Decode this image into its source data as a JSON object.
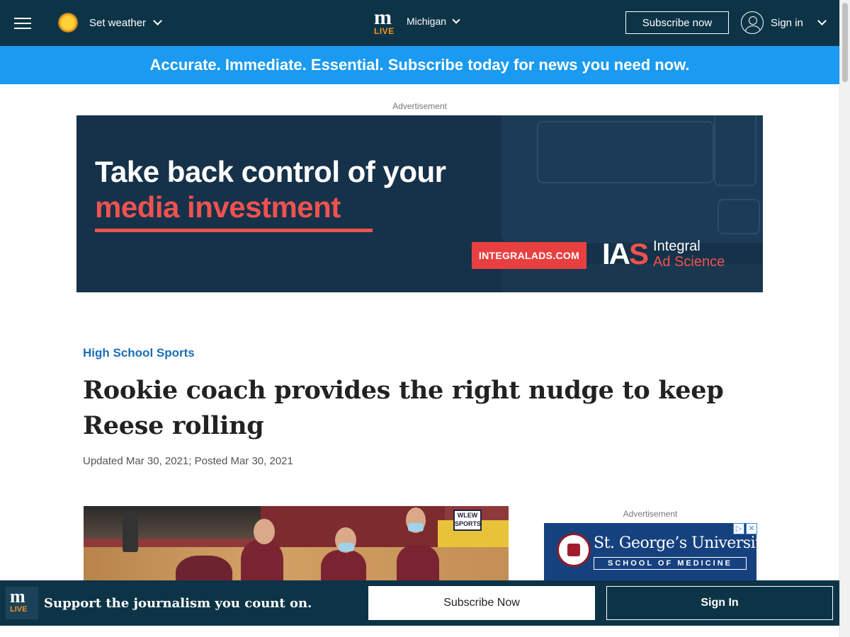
{
  "header": {
    "menu_icon": "hamburger-menu-icon",
    "weather_label": "Set weather",
    "logo_m": "m",
    "logo_live": "LIVE",
    "region_label": "Michigan",
    "subscribe_label": "Subscribe now",
    "signin_label": "Sign in"
  },
  "promo": {
    "text": "Accurate. Immediate. Essential. Subscribe today for news you need now."
  },
  "top_ad": {
    "label": "Advertisement",
    "headline_1": "Take back control of your",
    "headline_2": "media investment",
    "cta": "INTEGRALADS.COM",
    "brand_mark_1": "IA",
    "brand_mark_2": "S",
    "brand_word_1": "Integral",
    "brand_word_2": "Ad Science"
  },
  "article": {
    "category": "High School Sports",
    "headline": "Rookie coach provides the right nudge to keep Reese rolling",
    "dateline": "Updated Mar 30, 2021; Posted Mar 30, 2021",
    "photo_sign": "WLEW SPORTS"
  },
  "side_ad": {
    "label": "Advertisement",
    "name": "St. George’s University",
    "school": "SCHOOL OF MEDICINE",
    "adchoices_1": "▷",
    "adchoices_2": "✕"
  },
  "bottom_bar": {
    "logo_m": "m",
    "logo_live": "LIVE",
    "support_text": "Support the journalism you count on.",
    "subscribe_label": "Subscribe Now",
    "signin_label": "Sign In"
  },
  "colors": {
    "navy": "#0d3446",
    "promo_blue": "#1a9af1",
    "category_blue": "#1a6fb5",
    "brand_orange": "#f7931e",
    "ad_red": "#f0524f"
  }
}
